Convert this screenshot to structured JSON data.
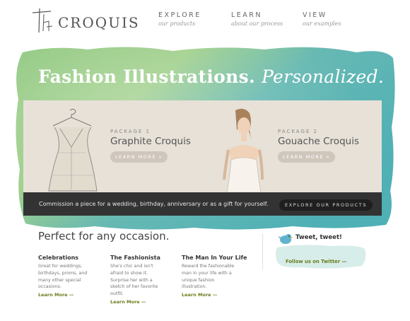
{
  "header": {
    "logo_text": "CROQUIS",
    "logo_monogram": "THE",
    "nav": [
      {
        "title": "EXPLORE",
        "subtitle": "our products"
      },
      {
        "title": "LEARN",
        "subtitle": "about our process"
      },
      {
        "title": "VIEW",
        "subtitle": "our examples"
      }
    ]
  },
  "hero": {
    "title_bold": "Fashion Illustrations.",
    "title_italic": "Personalized."
  },
  "packages": [
    {
      "label": "PACKAGE 1",
      "name": "Graphite Croquis",
      "button": "LEARN MORE »"
    },
    {
      "label": "PACKAGE 2",
      "name": "Gouache Croquis",
      "button": "LEARN MORE »"
    }
  ],
  "commission": {
    "text": "Commission a piece for a wedding, birthday, anniversary or as a gift for yourself.",
    "button": "EXPLORE OUR PRODUCTS"
  },
  "occasions": {
    "title": "Perfect for any occasion.",
    "columns": [
      {
        "title": "Celebrations",
        "text": [
          "Great for weddings,",
          "birthdays, proms, and",
          "many other special",
          "occasions."
        ],
        "link": "Learn More —"
      },
      {
        "title": "The Fashionista",
        "text": [
          "She's chic and isn't",
          "afraid to show it.",
          "Surprise her with a",
          "sketch of her favorite",
          "outfit."
        ],
        "link": "Learn More —"
      },
      {
        "title": "The Man In Your Life",
        "text": [
          "Reward the fashionable",
          "man in your life with a",
          "unique fashion",
          "illustration."
        ],
        "link": "Learn More —"
      }
    ]
  },
  "twitter": {
    "title": "Tweet, tweet!",
    "link": "Follow us on Twitter —"
  },
  "colors": {
    "watercolor_teal": "#5fb7b4",
    "watercolor_green": "#8cc37a",
    "panel_bg": "#e7e1d8",
    "bar_bg": "#333333",
    "link_green": "#6a7d1c"
  }
}
